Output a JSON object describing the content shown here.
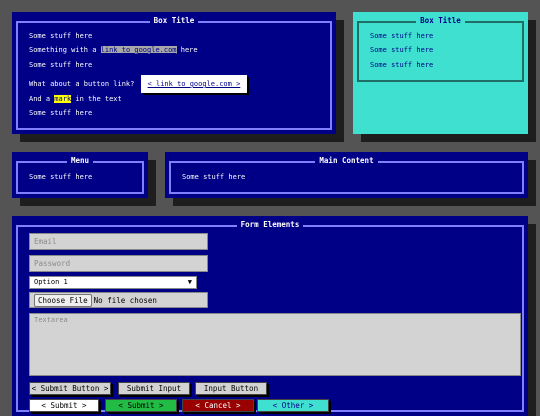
{
  "box1": {
    "title": "Box Title",
    "line1": "Some stuff here",
    "line2_prefix": "Something with a ",
    "line2_link": "link to google.com",
    "line2_suffix": " here",
    "line3": "Some stuff here",
    "line4_prefix": "What about a button link?",
    "line4_button": "< link to google.com >",
    "line5_prefix": "And a ",
    "line5_mark": "mark",
    "line5_suffix": " in the text",
    "line6": "Some stuff here"
  },
  "box2": {
    "title": "Box Title",
    "lines": [
      "Some stuff here",
      "Some stuff here",
      "Some stuff here"
    ]
  },
  "menu": {
    "title": "Menu",
    "line": "Some stuff here"
  },
  "main": {
    "title": "Main Content",
    "line": "Some stuff here"
  },
  "form": {
    "title": "Form Elements",
    "email_placeholder": "Email",
    "password_placeholder": "Password",
    "select_value": "Option 1",
    "file_button": "Choose File",
    "file_status": "No file chosen",
    "textarea_placeholder": "Textarea",
    "buttons_row1": [
      "< Submit Button >",
      "Submit Input",
      "Input Button"
    ],
    "buttons_row2": [
      "< Submit >",
      "< Submit >",
      "< Cancel >",
      "< Other >"
    ]
  },
  "colors": {
    "page_bg": "#545454",
    "panel_bg": "#000087",
    "teal": "#40e0d0",
    "border": "#8080ff",
    "mark": "#ffff00",
    "success": "#22bb44",
    "danger": "#990000"
  }
}
